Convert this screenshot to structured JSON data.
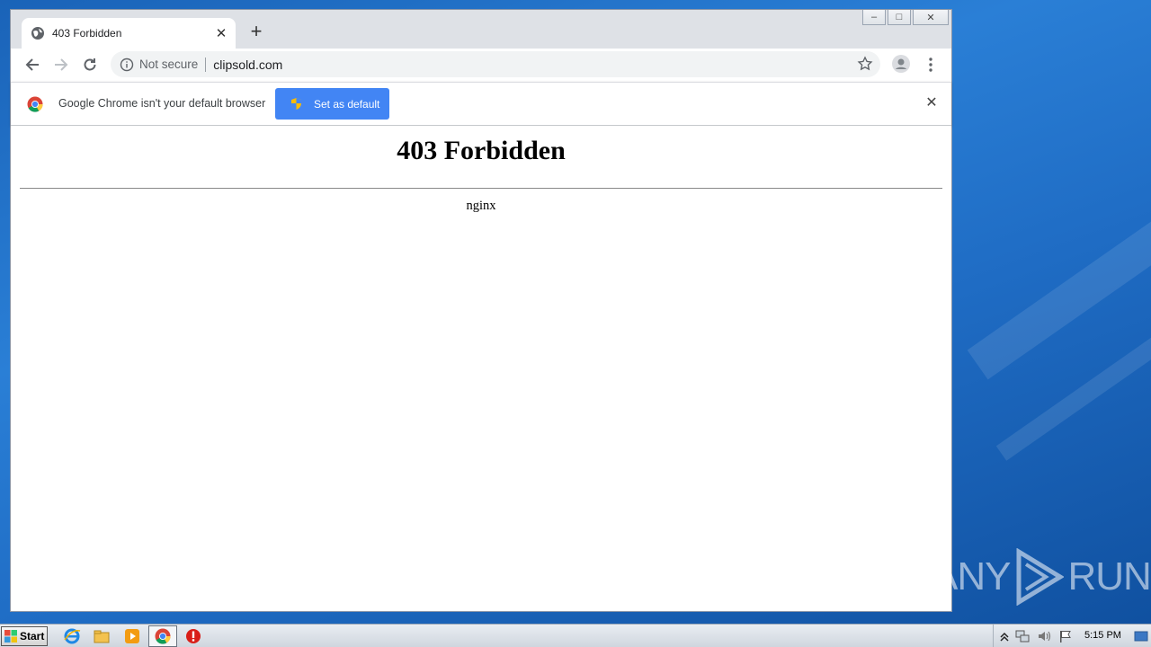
{
  "browser": {
    "tab_title": "403 Forbidden",
    "new_tab_symbol": "+",
    "security_label": "Not secure",
    "url": "clipsold.com"
  },
  "infobar": {
    "message": "Google Chrome isn't your default browser",
    "button_label": "Set as default"
  },
  "page": {
    "heading": "403 Forbidden",
    "server": "nginx"
  },
  "taskbar": {
    "start_label": "Start",
    "clock": "5:15 PM"
  },
  "watermark": {
    "left": "ANY",
    "right": "RUN"
  },
  "colors": {
    "accent_button": "#4285f4",
    "tab_strip": "#dee1e6",
    "omnibox_bg": "#f1f3f4"
  },
  "icons": [
    "globe-icon",
    "close-icon",
    "back-icon",
    "forward-icon",
    "reload-icon",
    "info-icon",
    "star-icon",
    "profile-icon",
    "menu-icon",
    "chrome-logo-icon",
    "shield-icon",
    "windows-icon",
    "ie-icon",
    "explorer-icon",
    "media-player-icon",
    "chrome-icon",
    "stop-icon",
    "flag-icon",
    "speaker-icon",
    "network-icon"
  ]
}
